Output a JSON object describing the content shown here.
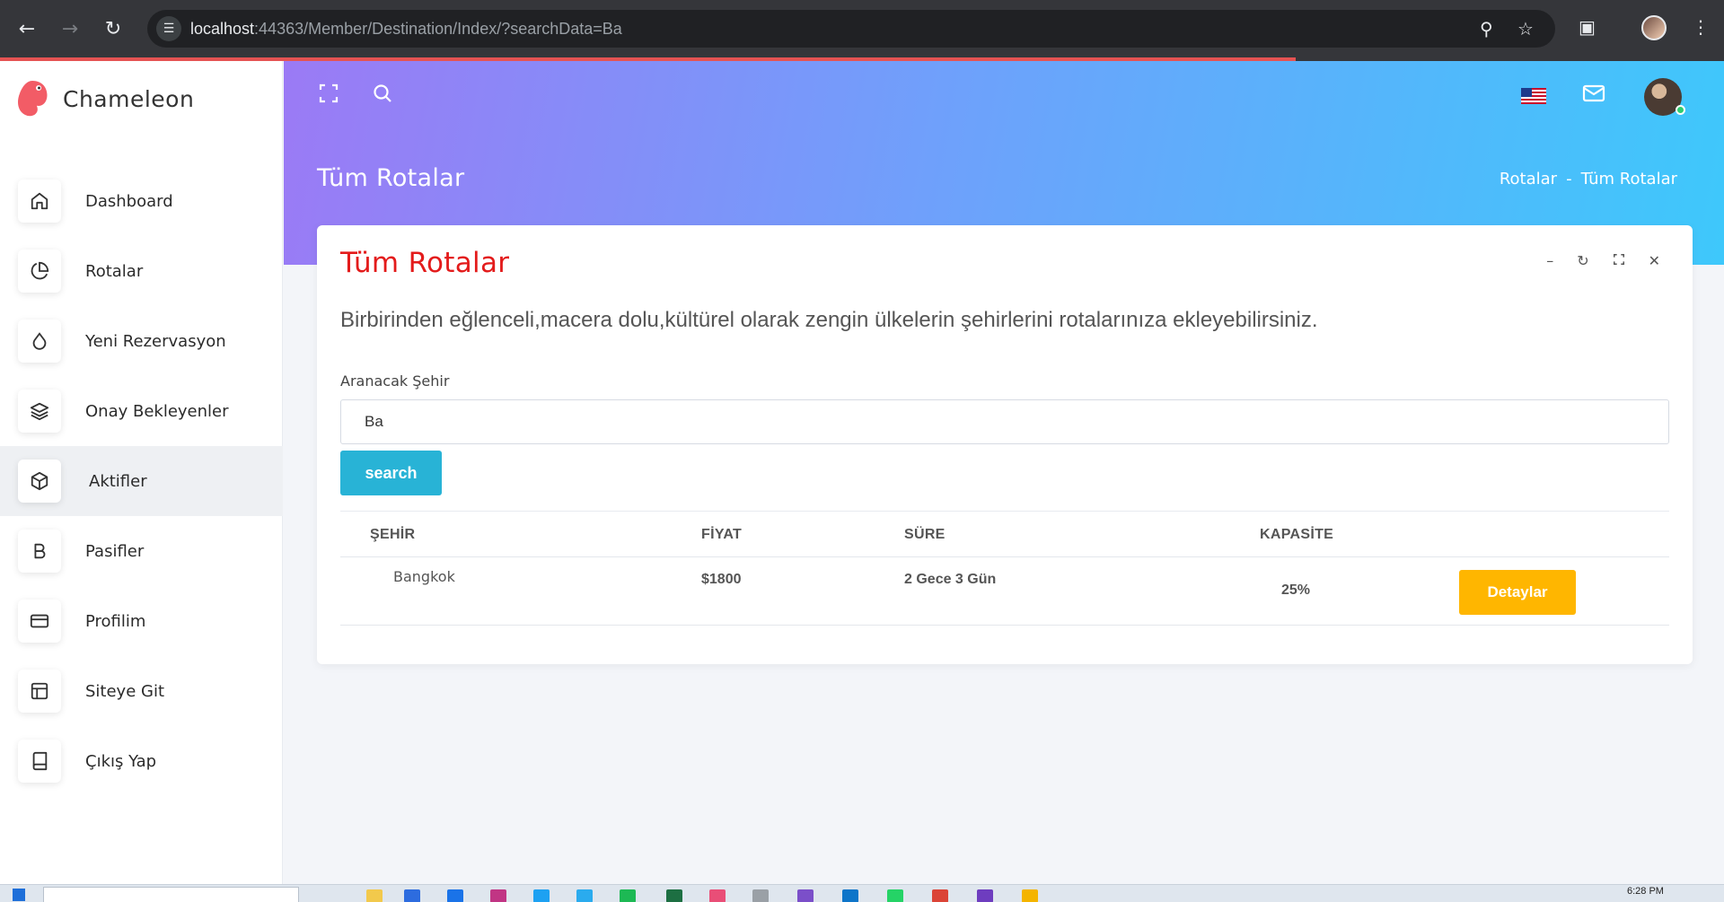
{
  "browser": {
    "url_host": "localhost",
    "url_rest": ":44363/Member/Destination/Index/?searchData=Ba"
  },
  "sidebar": {
    "brand": "Chameleon",
    "items": [
      {
        "label": "Dashboard",
        "icon": "home-icon"
      },
      {
        "label": "Rotalar",
        "icon": "pie-chart-icon"
      },
      {
        "label": "Yeni Rezervasyon",
        "icon": "droplet-icon"
      },
      {
        "label": "Onay Bekleyenler",
        "icon": "layers-icon"
      },
      {
        "label": "Aktifler",
        "icon": "box-icon",
        "active": true
      },
      {
        "label": "Pasifler",
        "icon": "bold-b-icon"
      },
      {
        "label": "Profilim",
        "icon": "credit-card-icon"
      },
      {
        "label": "Siteye Git",
        "icon": "layout-icon"
      },
      {
        "label": "Çıkış Yap",
        "icon": "book-icon"
      }
    ]
  },
  "header": {
    "page_title": "Tüm Rotalar",
    "breadcrumb_parent": "Rotalar",
    "breadcrumb_sep": "-",
    "breadcrumb_current": "Tüm Rotalar"
  },
  "card": {
    "title": "Tüm Rotalar",
    "description": "Birbirinden eğlenceli,macera dolu,kültürel olarak zengin ülkelerin şehirlerini rotalarınıza ekleyebilirsiniz.",
    "search_label": "Aranacak Şehir",
    "search_value": "Ba",
    "search_button": "search"
  },
  "table": {
    "headers": [
      "ŞEHİR",
      "FİYAT",
      "SÜRE",
      "KAPASİTE"
    ],
    "rows": [
      {
        "city": "Bangkok",
        "price": "$1800",
        "duration": "2 Gece 3 Gün",
        "capacity": "25%",
        "action": "Detaylar"
      }
    ]
  },
  "taskbar": {
    "clock": "6:28 PM"
  },
  "colors": {
    "accent_title": "#e31b1b",
    "search_button": "#28b3d6",
    "detail_button": "#ffb600",
    "header_gradient_start": "#9b7af5",
    "header_gradient_end": "#3ec8fb"
  }
}
